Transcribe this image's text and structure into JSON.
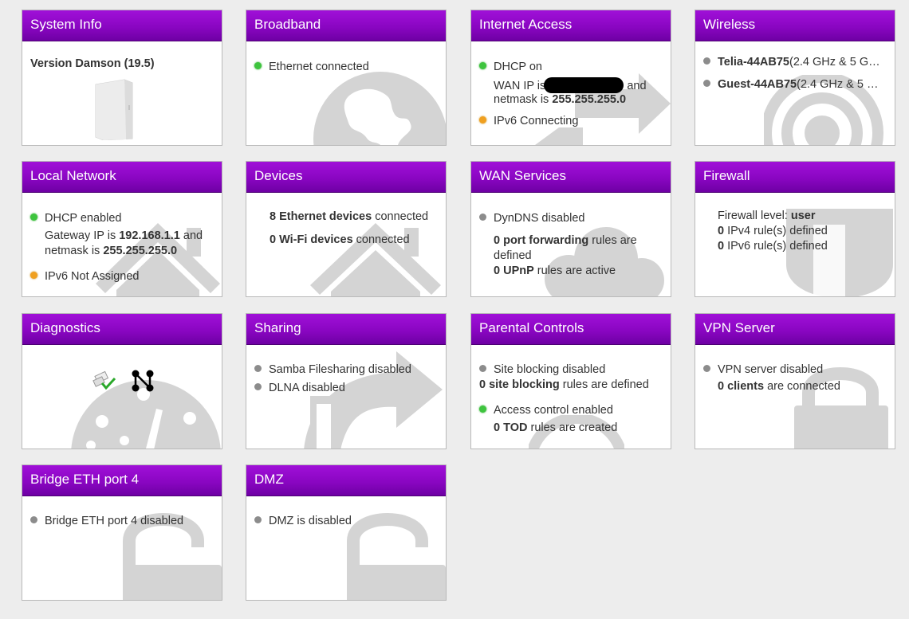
{
  "colors": {
    "header_top": "#a010d8",
    "header_bottom": "#6e00a4",
    "green": "#3ec43e",
    "orange": "#f0a020",
    "gray": "#8c8c8c"
  },
  "system_info": {
    "title": "System Info",
    "version": "Version Damson (19.5)"
  },
  "broadband": {
    "title": "Broadband",
    "status": "Ethernet connected"
  },
  "internet_access": {
    "title": "Internet Access",
    "dhcp": "DHCP on",
    "wan_ip_prefix": "WAN IP is",
    "wan_ip_suffix": "and",
    "netmask_prefix": "netmask is",
    "netmask": "255.255.255.0",
    "ipv6": "IPv6 Connecting"
  },
  "wireless": {
    "title": "Wireless",
    "ssid1": "Telia-44AB75",
    "ssid1_info": "(2.4 GHz & 5 G…",
    "ssid2": "Guest-44AB75",
    "ssid2_info": "(2.4 GHz & 5 …"
  },
  "local_network": {
    "title": "Local Network",
    "dhcp": "DHCP enabled",
    "gateway_prefix": "Gateway IP is",
    "gateway_ip": "192.168.1.1",
    "gateway_suffix": "and",
    "netmask_prefix": "netmask is",
    "netmask": "255.255.255.0",
    "ipv6": "IPv6 Not Assigned"
  },
  "devices": {
    "title": "Devices",
    "eth_count": "8 Ethernet devices",
    "eth_suffix": "connected",
    "wifi_count": "0 Wi-Fi devices",
    "wifi_suffix": "connected"
  },
  "wan_services": {
    "title": "WAN Services",
    "dyndns": "DynDNS disabled",
    "pf_count": "0 port forwarding",
    "pf_suffix": "rules are",
    "pf_suffix2": "defined",
    "upnp_count": "0 UPnP",
    "upnp_suffix": "rules are active"
  },
  "firewall": {
    "title": "Firewall",
    "level_prefix": "Firewall level:",
    "level": "user",
    "ipv4_count": "0",
    "ipv4_text": "IPv4 rule(s) defined",
    "ipv6_count": "0",
    "ipv6_text": "IPv6 rule(s) defined"
  },
  "diagnostics": {
    "title": "Diagnostics",
    "icon1": "check-ok-icon",
    "icon2": "network-nodes-icon"
  },
  "sharing": {
    "title": "Sharing",
    "samba": "Samba Filesharing disabled",
    "dlna": "DLNA disabled"
  },
  "parental_controls": {
    "title": "Parental Controls",
    "site_blocking": "Site blocking disabled",
    "sb_count": "0 site blocking",
    "sb_suffix": "rules are defined",
    "access_control": "Access control enabled",
    "tod_count": "0 TOD",
    "tod_suffix": "rules are created"
  },
  "vpn_server": {
    "title": "VPN Server",
    "status": "VPN server disabled",
    "clients_count": "0 clients",
    "clients_suffix": "are connected"
  },
  "bridge": {
    "title": "Bridge ETH port 4",
    "status": "Bridge ETH port 4 disabled"
  },
  "dmz": {
    "title": "DMZ",
    "status": "DMZ is disabled"
  }
}
